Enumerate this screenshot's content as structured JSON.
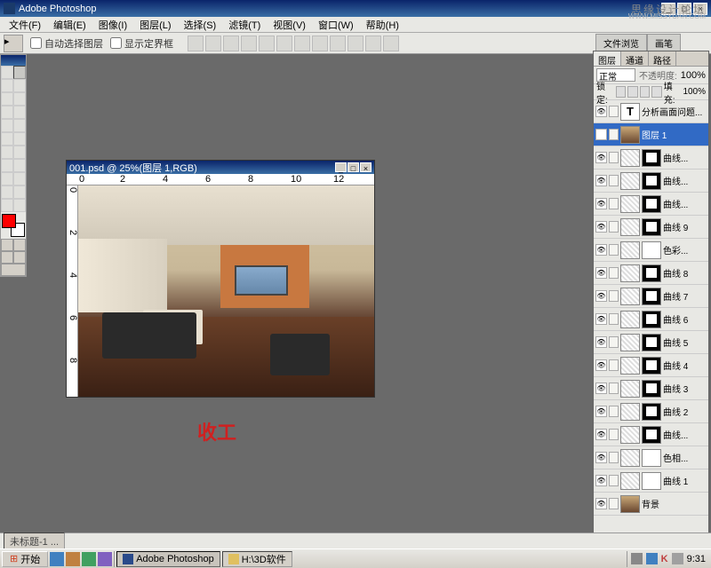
{
  "app": {
    "title": "Adobe Photoshop"
  },
  "menu": [
    "文件(F)",
    "编辑(E)",
    "图像(I)",
    "图层(L)",
    "选择(S)",
    "滤镜(T)",
    "视图(V)",
    "窗口(W)",
    "帮助(H)"
  ],
  "options": {
    "auto_select": "自动选择图层",
    "show_bounds": "显示定界框",
    "tabs": [
      "文件浏览",
      "画笔"
    ]
  },
  "watermark": {
    "main": "思缘设计论坛",
    "sub": "WWW.MISSYUAN.COM"
  },
  "doc": {
    "title": "001.psd @ 25%(图层 1,RGB)",
    "ruler_h": [
      "0",
      "2",
      "4",
      "6",
      "8",
      "10",
      "12"
    ],
    "ruler_v": [
      "0",
      "2",
      "4",
      "6",
      "8"
    ]
  },
  "annotation": "收工",
  "layers_panel": {
    "tabs": [
      "图层",
      "通道",
      "路径"
    ],
    "blend_mode": "正常",
    "opacity_label": "不透明度:",
    "opacity_value": "100%",
    "lock_label": "锁定:",
    "fill_label": "填充:",
    "fill_value": "100%",
    "layers": [
      {
        "name": "分析画面问题...",
        "type": "text"
      },
      {
        "name": "图层 1",
        "type": "image",
        "selected": true
      },
      {
        "name": "曲线...",
        "type": "adj",
        "mask": true
      },
      {
        "name": "曲线...",
        "type": "adj",
        "mask": true
      },
      {
        "name": "曲线...",
        "type": "adj",
        "mask": true
      },
      {
        "name": "曲线 9",
        "type": "adj",
        "mask": true
      },
      {
        "name": "色彩...",
        "type": "adj",
        "mask": "full"
      },
      {
        "name": "曲线 8",
        "type": "adj",
        "mask": true
      },
      {
        "name": "曲线 7",
        "type": "adj",
        "mask": true
      },
      {
        "name": "曲线 6",
        "type": "adj",
        "mask": true
      },
      {
        "name": "曲线 5",
        "type": "adj",
        "mask": true
      },
      {
        "name": "曲线 4",
        "type": "adj",
        "mask": true
      },
      {
        "name": "曲线 3",
        "type": "adj",
        "mask": true
      },
      {
        "name": "曲线 2",
        "type": "adj",
        "mask": true
      },
      {
        "name": "曲线...",
        "type": "adj",
        "mask": true
      },
      {
        "name": "色相...",
        "type": "adj",
        "mask": "full"
      },
      {
        "name": "曲线 1",
        "type": "adj",
        "mask": "full"
      },
      {
        "name": "背景",
        "type": "image"
      }
    ]
  },
  "statusbar": {
    "doc_label": "未标题-1 ..."
  },
  "taskbar": {
    "start": "开始",
    "tasks": [
      "Adobe Photoshop",
      "H:\\3D软件"
    ],
    "time": "9:31"
  }
}
